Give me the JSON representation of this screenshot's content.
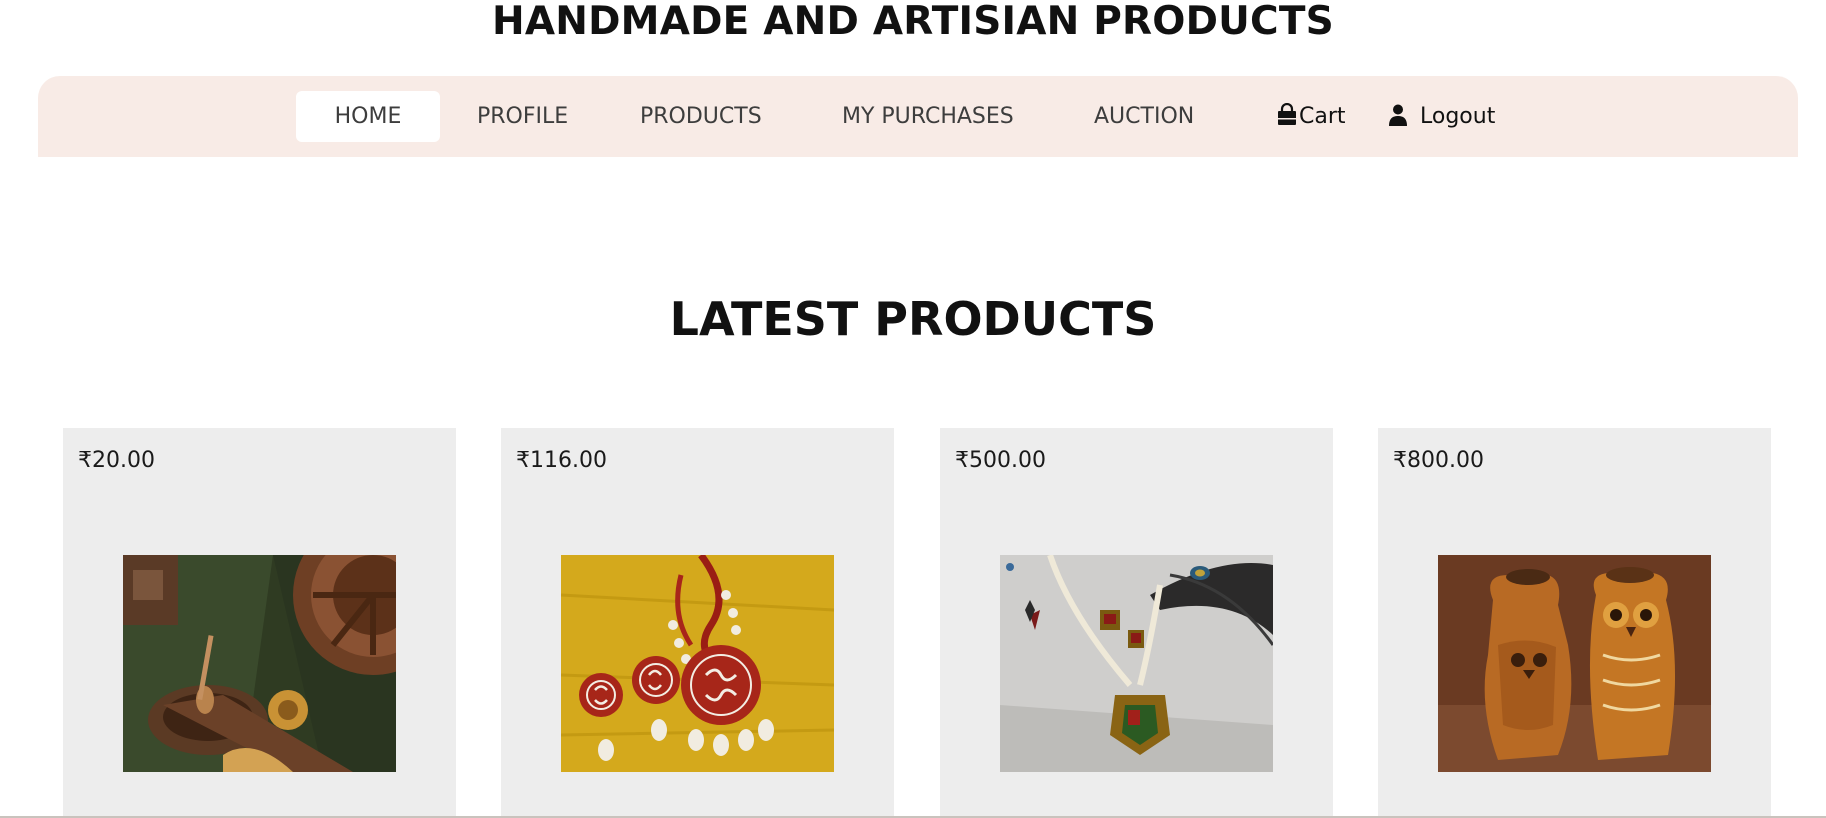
{
  "site": {
    "title": "HANDMADE AND ARTISIAN PRODUCTS"
  },
  "nav": {
    "items": [
      {
        "label": "HOME",
        "active": true
      },
      {
        "label": "PROFILE",
        "active": false
      },
      {
        "label": "PRODUCTS",
        "active": false
      },
      {
        "label": "MY PURCHASES",
        "active": false
      },
      {
        "label": "AUCTION",
        "active": false
      }
    ],
    "cart": {
      "label": "Cart",
      "icon": "shopping-bag-icon"
    },
    "logout": {
      "label": "Logout",
      "icon": "user-icon"
    }
  },
  "section": {
    "title": "LATEST PRODUCTS"
  },
  "products": [
    {
      "price": "₹20.00",
      "image": "wooden-spice-box-photo"
    },
    {
      "price": "₹116.00",
      "image": "red-terracotta-necklace-set-photo"
    },
    {
      "price": "₹500.00",
      "image": "pearl-pendant-necklace-photo"
    },
    {
      "price": "₹800.00",
      "image": "carved-wooden-owl-vases-photo"
    }
  ],
  "colors": {
    "navbar_bg": "#f8ebe6",
    "card_bg": "#ededed",
    "active_tab_bg": "#ffffff",
    "nav_text": "#3d3d3d"
  }
}
